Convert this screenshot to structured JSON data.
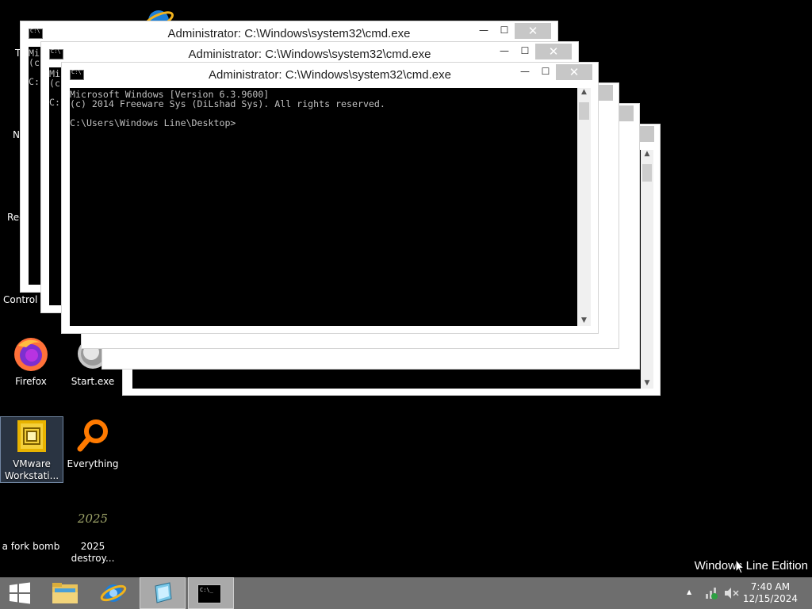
{
  "desktop": {
    "icons": [
      {
        "id": "firefox",
        "label": "Firefox"
      },
      {
        "id": "start_exe",
        "label": "Start.exe"
      },
      {
        "id": "vmware",
        "label": "VMware Workstati..."
      },
      {
        "id": "everything",
        "label": "Everything"
      },
      {
        "id": "fork_bomb",
        "label": "a fork bomb"
      },
      {
        "id": "destroy",
        "label": "2025 destroy..."
      }
    ],
    "clipped_labels": {
      "t": "T",
      "n": "N",
      "rec": "Rec",
      "control": "Control P"
    },
    "note_text": "2025"
  },
  "windows": [
    {
      "title": "Administrator: C:\\Windows\\system32\\cmd.exe"
    },
    {
      "title": "Administrator: C:\\Windows\\system32\\cmd.exe"
    },
    {
      "title": "Administrator: C:\\Windows\\system32\\cmd.exe"
    }
  ],
  "console": {
    "line1": "Microsoft Windows [Version 6.3.9600]",
    "line2": "(c) 2014 Freeware Sys (DiLshad Sys). All rights reserved.",
    "line3": "",
    "line4": "C:\\Users\\Windows Line\\Desktop>",
    "back_line1": "Mi",
    "back_line2": "(c",
    "back_line3": "C:"
  },
  "caption": {
    "minimize": "—",
    "maximize": "☐",
    "close": "✕"
  },
  "taskbar": {
    "clock_time": "7:40 AM",
    "clock_date": "12/15/2024",
    "tray_arrow": "▲"
  },
  "watermark": "Windows Line Edition"
}
